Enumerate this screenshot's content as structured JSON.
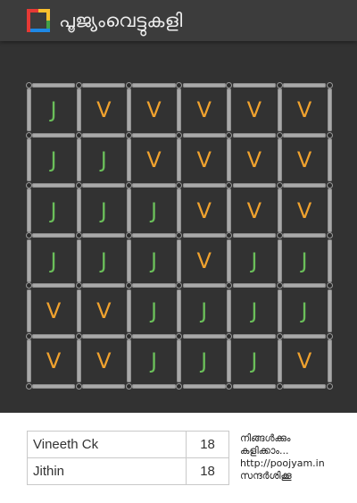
{
  "header": {
    "title": "പൂജ്യംവെട്ടുകളി",
    "logo_icon": "game-logo-icon",
    "logo_colors": [
      "#e53935",
      "#fbc02d",
      "#43a047",
      "#1e88e5"
    ]
  },
  "board": {
    "rows": 6,
    "cols": 6,
    "colors": {
      "J": "#6bbf5a",
      "V": "#f0a22e"
    },
    "cells": [
      [
        "J",
        "V",
        "V",
        "V",
        "V",
        "V"
      ],
      [
        "J",
        "J",
        "V",
        "V",
        "V",
        "V"
      ],
      [
        "J",
        "J",
        "J",
        "V",
        "V",
        "V"
      ],
      [
        "J",
        "J",
        "J",
        "V",
        "J",
        "J"
      ],
      [
        "V",
        "V",
        "J",
        "J",
        "J",
        "J"
      ],
      [
        "V",
        "V",
        "J",
        "J",
        "J",
        "V"
      ]
    ]
  },
  "scoreboard": {
    "players": [
      {
        "name": "Vineeth Ck",
        "score": "18"
      },
      {
        "name": "Jithin",
        "score": "18"
      }
    ]
  },
  "promo": {
    "line1": "നിങ്ങൾക്കും",
    "line2": "കളിക്കാം...",
    "url": "http://poojyam.in",
    "line4": "സന്ദർശിക്കൂ"
  }
}
